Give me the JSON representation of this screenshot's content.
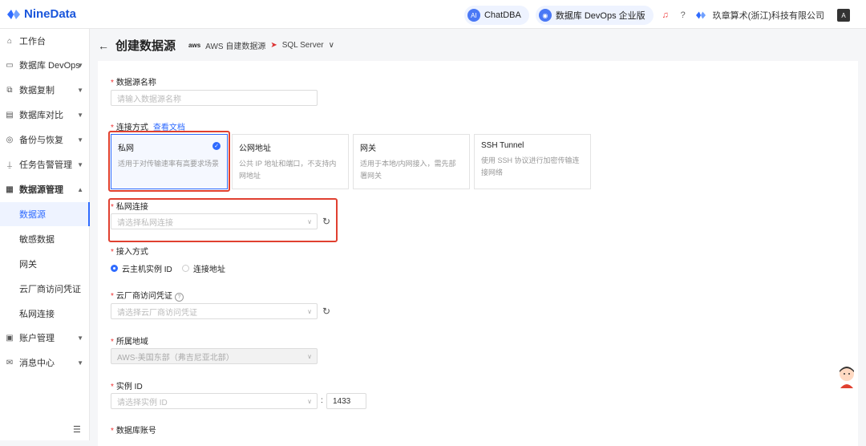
{
  "app": {
    "name": "NineData"
  },
  "topbar": {
    "chatdba": "ChatDBA",
    "devops_edition": "数据库 DevOps 企业版",
    "company": "玖章算术(浙江)科技有限公司"
  },
  "sidebar": {
    "items": [
      {
        "label": "工作台",
        "icon": "home-icon"
      },
      {
        "label": "数据库 DevOps",
        "icon": "monitor-icon"
      },
      {
        "label": "数据复制",
        "icon": "copy-icon"
      },
      {
        "label": "数据库对比",
        "icon": "compare-icon"
      },
      {
        "label": "备份与恢复",
        "icon": "backup-icon"
      },
      {
        "label": "任务告警管理",
        "icon": "alarm-icon"
      },
      {
        "label": "数据源管理",
        "icon": "database-icon"
      }
    ],
    "subitems": [
      "数据源",
      "敏感数据",
      "网关",
      "云厂商访问凭证",
      "私网连接"
    ],
    "bottom_items": [
      {
        "label": "账户管理",
        "icon": "account-icon"
      },
      {
        "label": "消息中心",
        "icon": "mail-icon"
      }
    ]
  },
  "header": {
    "title": "创建数据源",
    "aws_logo": "aws",
    "source_type": "AWS 自建数据源",
    "db_type": "SQL Server"
  },
  "form": {
    "name": {
      "label": "数据源名称",
      "placeholder": "请输入数据源名称"
    },
    "connect": {
      "label": "连接方式",
      "doc_link": "查看文档",
      "options": [
        {
          "title": "私网",
          "desc": "适用于对传输速率有高要求场景"
        },
        {
          "title": "公网地址",
          "desc": "公共 IP 地址和端口，不支持内网地址"
        },
        {
          "title": "网关",
          "desc": "适用于本地/内网接入，需先部署网关"
        },
        {
          "title": "SSH Tunnel",
          "desc": "使用 SSH 协议进行加密传输连接网络"
        }
      ]
    },
    "private": {
      "label": "私网连接",
      "placeholder": "请选择私网连接"
    },
    "access": {
      "label": "接入方式",
      "option1": "云主机实例 ID",
      "option2": "连接地址"
    },
    "credential": {
      "label": "云厂商访问凭证",
      "placeholder": "请选择云厂商访问凭证"
    },
    "region": {
      "label": "所属地域",
      "value": "AWS-美国东部（弗吉尼亚北部）"
    },
    "instance": {
      "label": "实例 ID",
      "placeholder": "请选择实例 ID",
      "port": "1433"
    },
    "account": {
      "label": "数据库账号"
    }
  }
}
